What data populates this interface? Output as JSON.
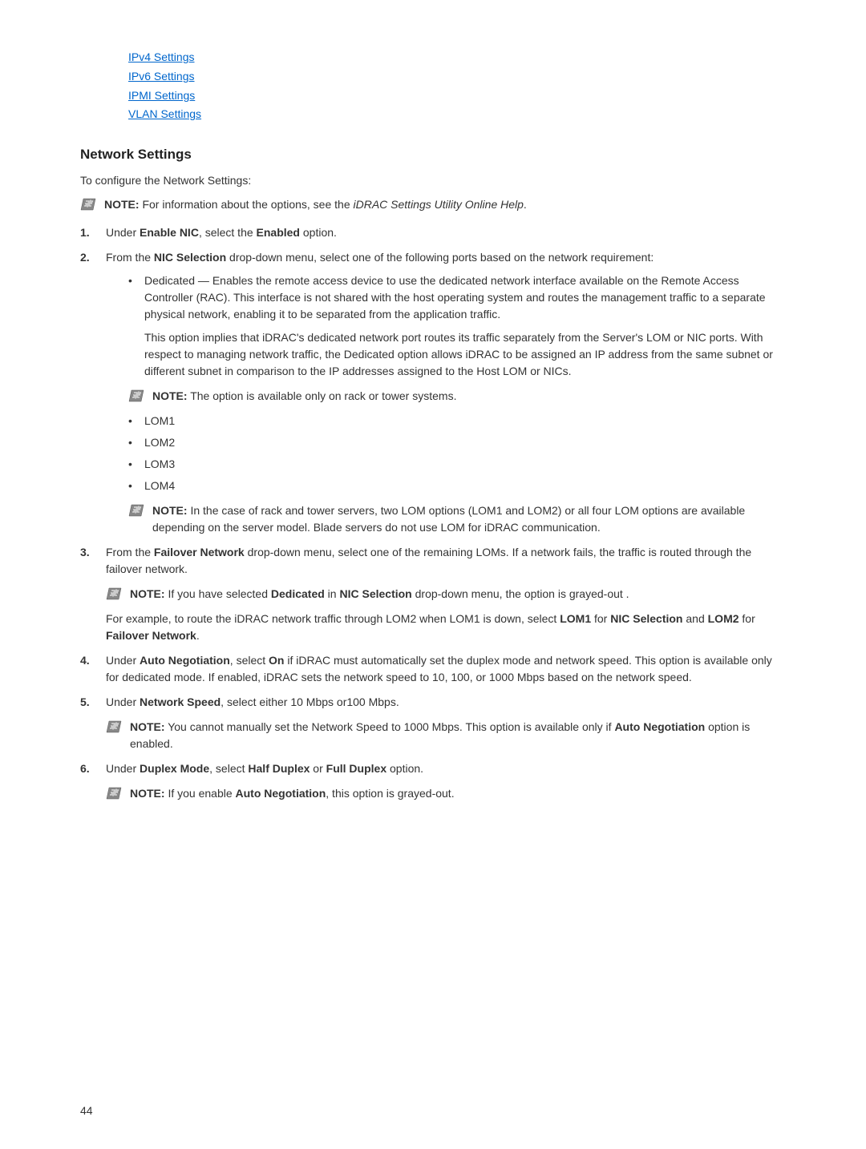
{
  "links": {
    "ipv4": "IPv4 Settings",
    "ipv6": "IPv6 Settings",
    "ipmi": "IPMI Settings",
    "vlan": "VLAN Settings"
  },
  "heading": "Network Settings",
  "intro": "To configure the Network Settings:",
  "note0": {
    "label": "NOTE:",
    "text": " For information about the options, see the ",
    "italic": "iDRAC Settings Utility Online Help",
    "suffix": "."
  },
  "step1": {
    "prefix": "Under ",
    "b1": "Enable NIC",
    "mid": ", select the ",
    "b2": "Enabled",
    "suffix": " option."
  },
  "step2": {
    "prefix": "From the ",
    "b1": "NIC Selection",
    "suffix": " drop-down menu, select one of the following ports based on the network requirement:",
    "bullet_dedicated": "Dedicated — Enables the remote access device to use the dedicated network interface available on the Remote Access Controller (RAC). This interface is not shared with the host operating system and routes the management traffic to a separate physical network, enabling it to be separated from the application traffic.",
    "dedicated_para": "This option implies that iDRAC's dedicated network port routes its traffic separately from the Server's LOM or NIC ports. With respect to managing network traffic, the Dedicated option allows iDRAC to be assigned an IP address from the same subnet or different subnet in comparison to the IP addresses assigned to the Host LOM or NICs.",
    "note1": {
      "label": "NOTE:",
      "text": " The option is available only on rack or tower systems."
    },
    "lom1": "LOM1",
    "lom2": "LOM2",
    "lom3": "LOM3",
    "lom4": "LOM4",
    "note2": {
      "label": "NOTE:",
      "text": " In the case of rack and tower servers, two LOM options (LOM1 and LOM2) or all four LOM options are available depending on the server model. Blade servers do not use LOM for iDRAC communication."
    }
  },
  "step3": {
    "prefix": "From the ",
    "b1": "Failover Network",
    "suffix": " drop-down menu, select one of the remaining LOMs. If a network fails, the traffic is routed through the failover network.",
    "note": {
      "label": "NOTE:",
      "t1": " If you have selected ",
      "b1": "Dedicated",
      "t2": " in ",
      "b2": "NIC Selection",
      "t3": " drop-down menu, the option is grayed-out ."
    },
    "example": {
      "t1": "For example, to route the iDRAC network traffic through LOM2 when LOM1 is down, select ",
      "b1": "LOM1",
      "t2": " for ",
      "b2": "NIC Selection",
      "t3": " and ",
      "b3": "LOM2",
      "t4": " for ",
      "b4": "Failover Network",
      "t5": "."
    }
  },
  "step4": {
    "t1": "Under ",
    "b1": "Auto Negotiation",
    "t2": ", select ",
    "b2": "On",
    "t3": " if iDRAC must automatically set the duplex mode and network speed. This option is available only for dedicated mode. If enabled, iDRAC sets the network speed to 10, 100, or 1000 Mbps based on the network speed."
  },
  "step5": {
    "t1": "Under ",
    "b1": "Network Speed",
    "t2": ", select either 10 Mbps or100 Mbps.",
    "note": {
      "label": "NOTE:",
      "t1": " You cannot manually set the Network Speed to 1000 Mbps. This option is available only if ",
      "b1": "Auto Negotiation",
      "t2": " option is enabled."
    }
  },
  "step6": {
    "t1": "Under ",
    "b1": "Duplex Mode",
    "t2": ", select ",
    "b2": "Half Duplex",
    "t3": " or ",
    "b3": "Full Duplex",
    "t4": " option.",
    "note": {
      "label": "NOTE:",
      "t1": " If you enable ",
      "b1": "Auto Negotiation",
      "t2": ", this option is grayed-out."
    }
  },
  "page_num": "44"
}
